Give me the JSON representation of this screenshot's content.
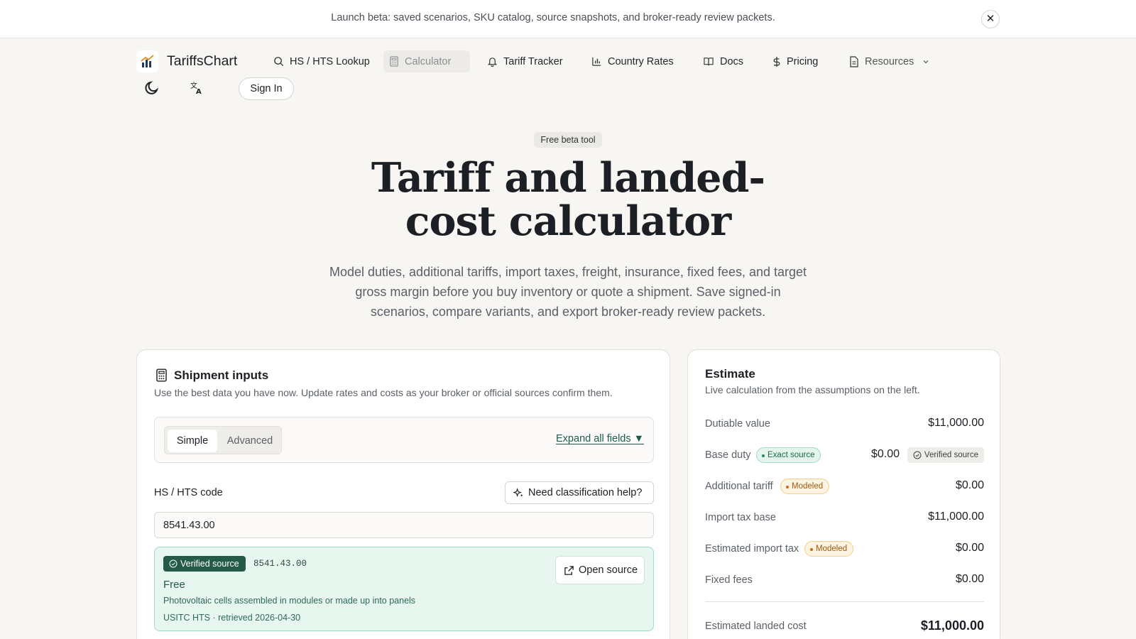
{
  "banner": {
    "text": "Launch beta: saved scenarios, SKU catalog, source snapshots, and broker-ready review packets.",
    "close_icon": "✕"
  },
  "nav": {
    "brand": "TariffsChart",
    "items": [
      {
        "label": "HS / HTS Lookup",
        "icon": "search-icon"
      },
      {
        "label": "Calculator",
        "icon": "calculator-icon",
        "active": true
      },
      {
        "label": "Tariff Tracker",
        "icon": "bell-icon"
      },
      {
        "label": "Country Rates",
        "icon": "bar-chart-icon"
      },
      {
        "label": "Docs",
        "icon": "book-icon"
      },
      {
        "label": "Pricing",
        "icon": "dollar-icon"
      },
      {
        "label": "Resources",
        "icon": "file-icon",
        "has_dropdown": true
      }
    ],
    "sign_in": "Sign In"
  },
  "hero": {
    "badge": "Free beta tool",
    "title_line1": "Tariff and landed-",
    "title_line2": "cost calculator",
    "subtitle": "Model duties, additional tariffs, import taxes, freight, insurance, fixed fees, and target gross margin before you buy inventory or quote a shipment. Save signed-in scenarios, compare variants, and export broker-ready review packets."
  },
  "inputs": {
    "title": "Shipment inputs",
    "subtitle": "Use the best data you have now. Update rates and costs as your broker or official sources confirm them.",
    "mode_simple": "Simple",
    "mode_advanced": "Advanced",
    "expand_all": "Expand all fields ▼",
    "hts_label": "HS / HTS code",
    "help_button": "Need classification help?",
    "hts_value": "8541.43.00",
    "source": {
      "tag": "Verified source",
      "code": "8541.43.00",
      "rate": "Free",
      "description": "Photovoltaic cells assembled in modules or made up into panels",
      "meta": "USITC HTS · retrieved 2026-04-30",
      "open_button": "Open source"
    }
  },
  "estimate": {
    "title": "Estimate",
    "subtitle": "Live calculation from the assumptions on the left.",
    "rows": [
      {
        "label": "Dutiable value",
        "value": "$11,000.00"
      },
      {
        "label": "Base duty",
        "value": "$0.00",
        "badge": "Exact source",
        "chip": "Verified source"
      },
      {
        "label": "Additional tariff",
        "value": "$0.00",
        "badge": "Modeled"
      },
      {
        "label": "Import tax base",
        "value": "$11,000.00"
      },
      {
        "label": "Estimated import tax",
        "value": "$0.00",
        "badge": "Modeled"
      },
      {
        "label": "Fixed fees",
        "value": "$0.00"
      }
    ],
    "total_label": "Estimated landed cost",
    "total_value": "$11,000.00"
  },
  "colors": {
    "accent_green": "#1d5c4a",
    "verified_dark": "#245a49",
    "modeled_orange": "#c96a10",
    "page_bg": "#f7f6f3"
  }
}
